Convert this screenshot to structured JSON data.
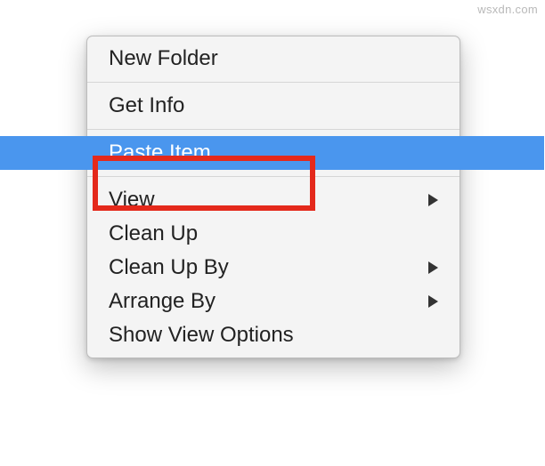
{
  "watermark": "wsxdn.com",
  "menu": {
    "items": [
      {
        "label": "New Folder",
        "submenu": false,
        "highlighted": false
      },
      {
        "separator": true
      },
      {
        "label": "Get Info",
        "submenu": false,
        "highlighted": false
      },
      {
        "separator": true
      },
      {
        "label": "Paste Item",
        "submenu": false,
        "highlighted": true
      },
      {
        "separator": true
      },
      {
        "label": "View",
        "submenu": true,
        "highlighted": false
      },
      {
        "label": "Clean Up",
        "submenu": false,
        "highlighted": false
      },
      {
        "label": "Clean Up By",
        "submenu": true,
        "highlighted": false
      },
      {
        "label": "Arrange By",
        "submenu": true,
        "highlighted": false
      },
      {
        "label": "Show View Options",
        "submenu": false,
        "highlighted": false
      }
    ]
  }
}
